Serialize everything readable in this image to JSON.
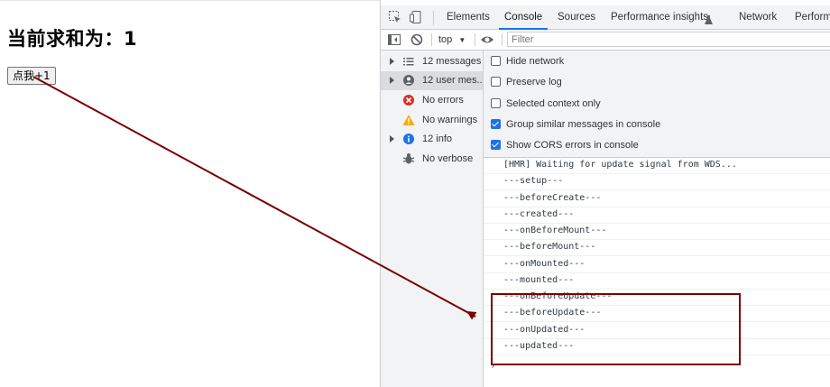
{
  "page": {
    "heading": "当前求和为：1",
    "button_label": "点我+1"
  },
  "devtools": {
    "tabs": [
      "Elements",
      "Console",
      "Sources",
      "Performance insights",
      "Network",
      "Performa"
    ],
    "active_tab": "Console",
    "toolbar": {
      "context": "top",
      "filter_placeholder": "Filter"
    },
    "sidebar": [
      {
        "label": "12 messages",
        "icon": "list-icon",
        "expandable": true
      },
      {
        "label": "12 user mes...",
        "icon": "user-icon",
        "expandable": true,
        "selected": true
      },
      {
        "label": "No errors",
        "icon": "error-icon",
        "expandable": false
      },
      {
        "label": "No warnings",
        "icon": "warning-icon",
        "expandable": false
      },
      {
        "label": "12 info",
        "icon": "info-icon",
        "expandable": true
      },
      {
        "label": "No verbose",
        "icon": "bug-icon",
        "expandable": false
      }
    ],
    "settings": [
      {
        "label": "Hide network",
        "checked": false
      },
      {
        "label": "Preserve log",
        "checked": false
      },
      {
        "label": "Selected context only",
        "checked": false
      },
      {
        "label": "Group similar messages in console",
        "checked": true
      },
      {
        "label": "Show CORS errors in console",
        "checked": true
      }
    ],
    "log": [
      "[HMR] Waiting for update signal from WDS...",
      "---setup---",
      "---beforeCreate---",
      "---created---",
      "---onBeforeMount---",
      "---beforeMount---",
      "---onMounted---",
      "---mounted---",
      "---onBeforeUpdate---",
      "---beforeUpdate---",
      "---onUpdated---",
      "---updated---"
    ],
    "prompt": "›"
  },
  "colors": {
    "accent": "#1a73e8",
    "annotation": "#7a0000",
    "error": "#d93025",
    "warning": "#f9ab00"
  }
}
